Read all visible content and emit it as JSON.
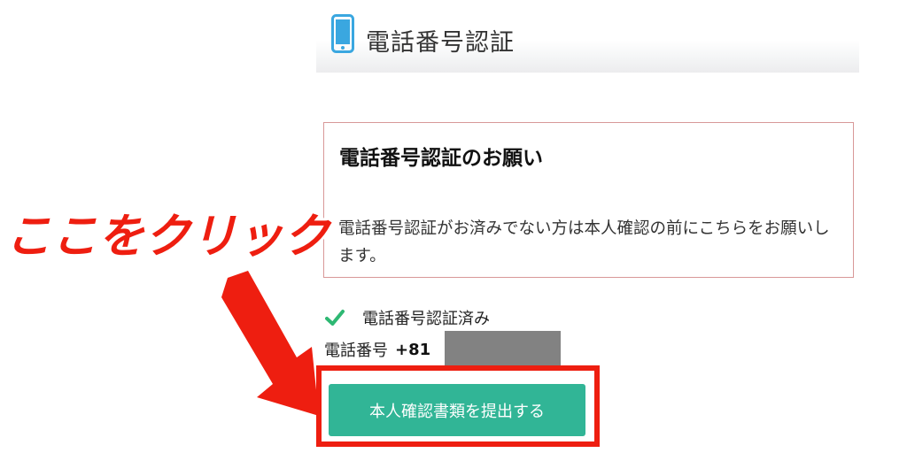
{
  "header": {
    "icon": "smartphone-icon",
    "title": "電話番号認証"
  },
  "notice": {
    "title": "電話番号認証のお願い",
    "body": "電話番号認証がお済みでない方は本人確認の前にこちらをお願いします。"
  },
  "verification": {
    "icon": "checkmark-icon",
    "status_text": "電話番号認証済み",
    "phone_label": "電話番号",
    "phone_code": "+81"
  },
  "submit_button": {
    "label": "本人確認書類を提出する"
  },
  "annotation": {
    "callout_text": "ここをクリック",
    "arrow_icon": "arrow-down-right-icon"
  },
  "colors": {
    "accent_button": "#31b596",
    "annotation_red": "#ee1e10",
    "phone_icon": "#3aa7e0",
    "check_green": "#2eb873",
    "notice_border": "#d89898"
  }
}
